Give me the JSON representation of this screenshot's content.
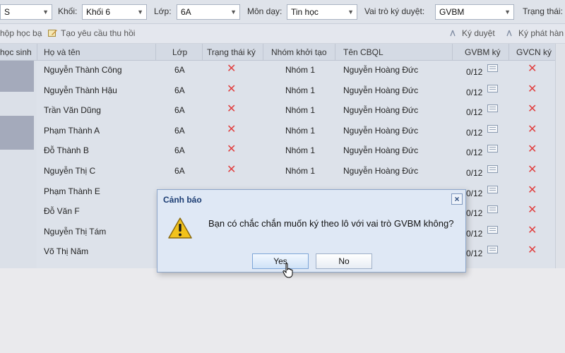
{
  "filters": {
    "first_value": "S",
    "khoi_label": "Khối:",
    "khoi_value": "Khối 6",
    "lop_label": "Lớp:",
    "lop_value": "6A",
    "mon_label": "Môn dạy:",
    "mon_value": "Tin học",
    "vaitro_label": "Vai trò ký duyệt:",
    "vaitro_value": "GVBM",
    "trangthai_label": "Trạng thái:"
  },
  "toolbar": {
    "nop_label": "hộp học bạ",
    "tao_label": "Tạo yêu cầu thu hồi",
    "kyduyet_label": "Ký duyệt",
    "kyphathanh_label": "Ký phát hàn"
  },
  "grid": {
    "headers": {
      "hocsinh": "học sinh",
      "hoten": "Họ và tên",
      "lop": "Lớp",
      "trangthai": "Trạng thái ký",
      "nhom": "Nhóm khởi tạo",
      "cbql": "Tên CBQL",
      "gvbm": "GVBM ký",
      "gvcn": "GVCN ký"
    },
    "rows": [
      {
        "name": "Nguyễn Thành Công",
        "lop": "6A",
        "nhom": "Nhóm 1",
        "cbql": "Nguyễn Hoàng Đức",
        "gvbm": "0/12"
      },
      {
        "name": "Nguyễn Thành Hậu",
        "lop": "6A",
        "nhom": "Nhóm 1",
        "cbql": "Nguyễn Hoàng Đức",
        "gvbm": "0/12"
      },
      {
        "name": "Trần Văn Dũng",
        "lop": "6A",
        "nhom": "Nhóm 1",
        "cbql": "Nguyễn Hoàng Đức",
        "gvbm": "0/12"
      },
      {
        "name": "Phạm Thành A",
        "lop": "6A",
        "nhom": "Nhóm 1",
        "cbql": "Nguyễn Hoàng Đức",
        "gvbm": "0/12"
      },
      {
        "name": "Đỗ Thành B",
        "lop": "6A",
        "nhom": "Nhóm 1",
        "cbql": "Nguyễn Hoàng Đức",
        "gvbm": "0/12"
      },
      {
        "name": "Nguyễn Thị C",
        "lop": "6A",
        "nhom": "Nhóm 1",
        "cbql": "Nguyễn Hoàng Đức",
        "gvbm": "0/12"
      },
      {
        "name": "Phạm Thành E",
        "lop": "",
        "nhom": "",
        "cbql": "",
        "gvbm": "0/12"
      },
      {
        "name": "Đỗ Văn F",
        "lop": "",
        "nhom": "",
        "cbql": "",
        "gvbm": "0/12"
      },
      {
        "name": "Nguyễn Thị Tám",
        "lop": "",
        "nhom": "",
        "cbql": "",
        "gvbm": "0/12"
      },
      {
        "name": "Võ Thị Năm",
        "lop": "",
        "nhom": "",
        "cbql": "",
        "gvbm": "0/12"
      }
    ]
  },
  "dialog": {
    "title": "Cảnh báo",
    "close": "×",
    "message": "Bạn có chắc chắn muốn ký theo lô với vai trò GVBM không?",
    "yes_label": "Yes",
    "no_label": "No"
  },
  "icons": {
    "warning": "warning-icon",
    "cross": "cross-icon",
    "document": "document-icon",
    "cursor": "hand-cursor-icon"
  },
  "colors": {
    "cross": "#e04040",
    "dialog_title": "#1c3d73",
    "warning": "#f2c21b"
  }
}
